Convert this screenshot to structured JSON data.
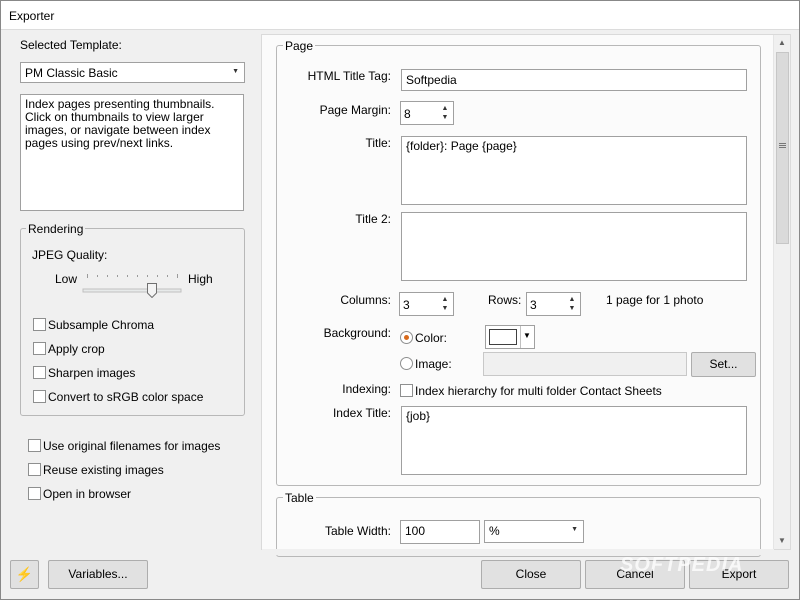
{
  "window": {
    "title": "Exporter"
  },
  "left": {
    "template_label": "Selected Template:",
    "template_value": "PM Classic Basic",
    "description": "Index pages presenting thumbnails. Click on thumbnails to view larger images, or navigate between index pages using prev/next links.",
    "rendering": {
      "title": "Rendering",
      "jpeg_label": "JPEG Quality:",
      "low_label": "Low",
      "high_label": "High",
      "jpeg_quality": 0.72,
      "checks": [
        {
          "label": "Subsample Chroma",
          "checked": false
        },
        {
          "label": "Apply crop",
          "checked": false
        },
        {
          "label": "Sharpen images",
          "checked": false
        },
        {
          "label": "Convert to sRGB color space",
          "checked": false
        }
      ]
    },
    "options": [
      {
        "label": "Use original filenames for images",
        "checked": false
      },
      {
        "label": "Reuse existing images",
        "checked": false
      },
      {
        "label": "Open in browser",
        "checked": false
      }
    ]
  },
  "page": {
    "title": "Page",
    "html_title_label": "HTML Title Tag:",
    "html_title_value": "Softpedia",
    "margin_label": "Page Margin:",
    "margin_value": "8",
    "title_label": "Title:",
    "title_value": "{folder}: Page {page}",
    "title2_label": "Title 2:",
    "title2_value": "",
    "columns_label": "Columns:",
    "columns_value": "3",
    "rows_label": "Rows:",
    "rows_value": "3",
    "page_info": "1 page for 1 photo",
    "background_label": "Background:",
    "color_label": "Color:",
    "color_value": "#ffffff",
    "image_label": "Image:",
    "image_value": "",
    "set_button": "Set...",
    "indexing_label": "Indexing:",
    "indexing_check": "Index hierarchy for multi folder Contact Sheets",
    "index_title_label": "Index Title:",
    "index_title_value": "{job}"
  },
  "table": {
    "title": "Table",
    "width_label": "Table Width:",
    "width_value": "100",
    "unit_value": "%"
  },
  "footer": {
    "lightning_icon": "lightning-icon",
    "variables": "Variables...",
    "close": "Close",
    "cancel": "Cancel",
    "export": "Export"
  },
  "watermark": "SOFTPEDIA"
}
